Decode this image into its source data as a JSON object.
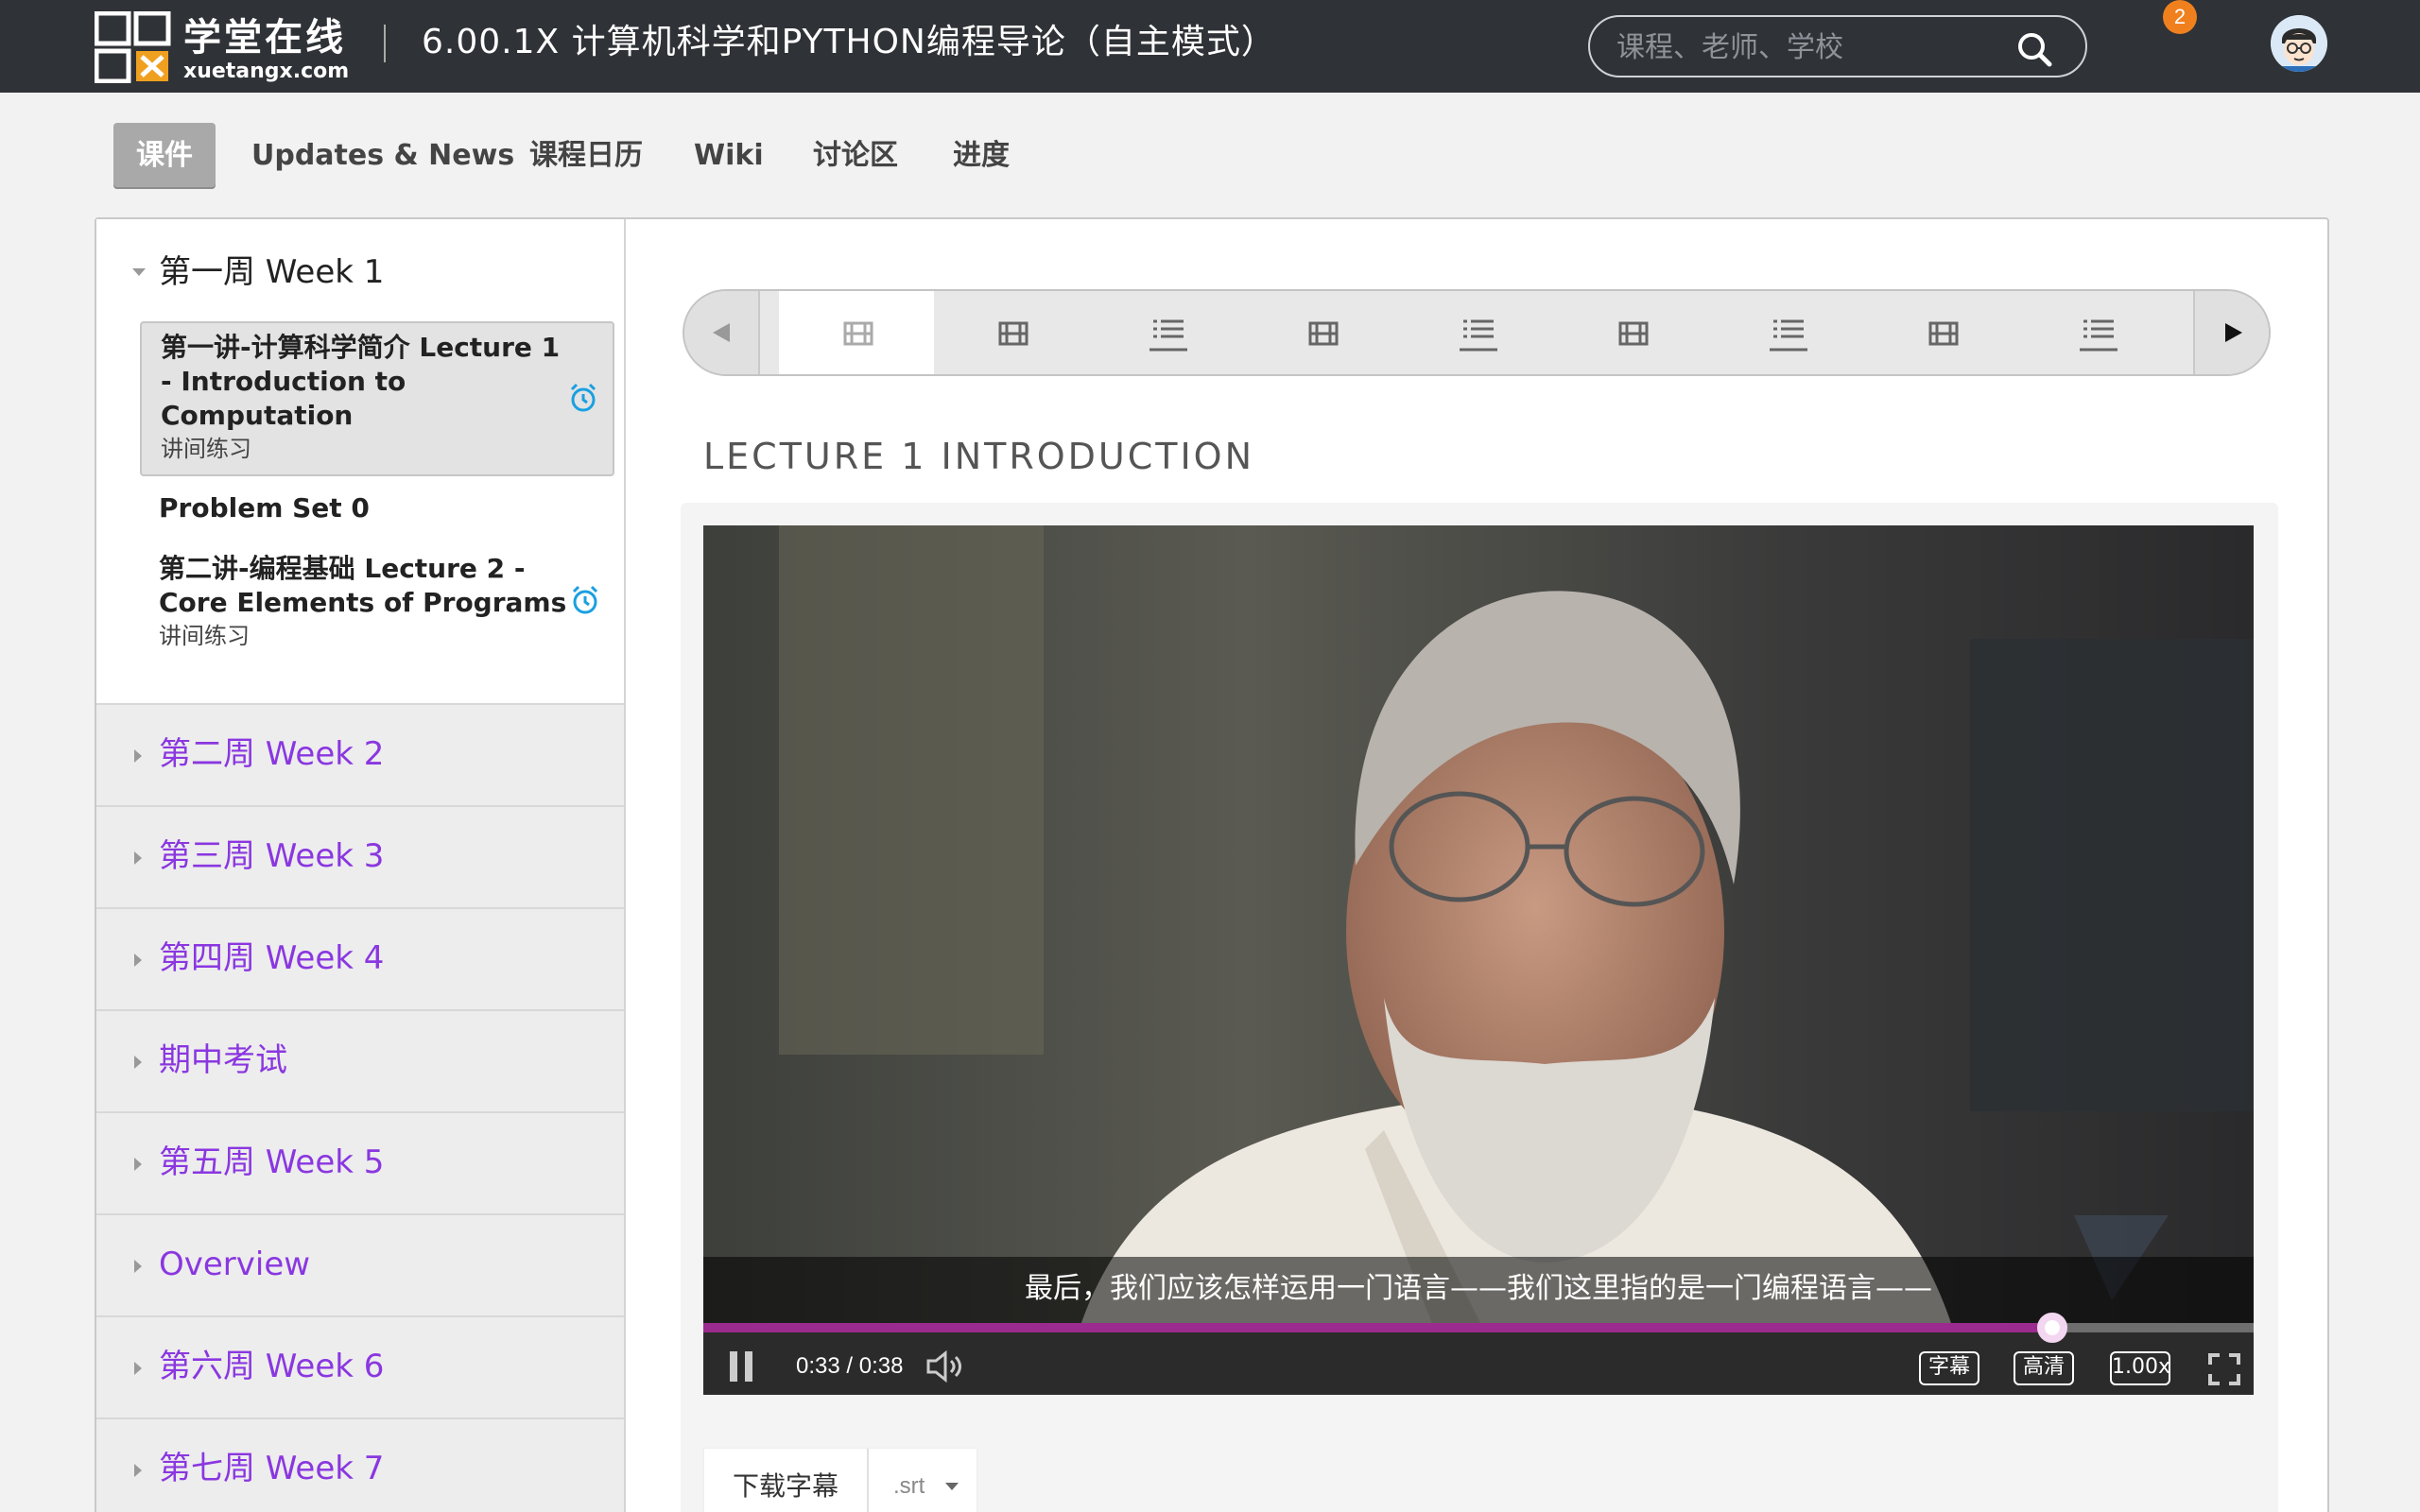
{
  "header": {
    "logo_text": "学堂在线",
    "logo_sub": "xuetangx.com",
    "course_title": "6.00.1X 计算机科学和PYTHON编程导论（自主模式）",
    "search_placeholder": "课程、老师、学校",
    "notification_count": "2",
    "colors": {
      "bar": "#2f3236",
      "badge": "#f0801e"
    }
  },
  "tabs": [
    {
      "label": "课件",
      "active": true
    },
    {
      "label": "Updates & News"
    },
    {
      "label": "课程日历"
    },
    {
      "label": "Wiki"
    },
    {
      "label": "讨论区"
    },
    {
      "label": "进度"
    }
  ],
  "sidebar": {
    "week1": {
      "title": "第一周 Week 1",
      "lessons": [
        {
          "title_lines": [
            "第一讲-计算科学简介 Lecture 1",
            "- Introduction to",
            "Computation"
          ],
          "subtitle": "讲间练习",
          "active": true,
          "icon": "alarm-clock-icon"
        },
        {
          "title_lines": [
            "Problem Set 0"
          ],
          "subtitle": ""
        },
        {
          "title_lines": [
            "第二讲-编程基础 Lecture 2 -",
            "Core Elements of Programs"
          ],
          "subtitle": "讲间练习",
          "icon": "alarm-clock-icon"
        }
      ]
    },
    "weeks": [
      {
        "label": "第二周 Week 2"
      },
      {
        "label": "第三周 Week 3"
      },
      {
        "label": "第四周 Week 4"
      },
      {
        "label": "期中考试"
      },
      {
        "label": "第五周 Week 5"
      },
      {
        "label": "Overview"
      },
      {
        "label": "第六周 Week 6"
      },
      {
        "label": "第七周 Week 7"
      }
    ],
    "link_color": "#8a37e0"
  },
  "sequence": {
    "items": [
      "video-icon",
      "video-icon",
      "list-icon",
      "video-icon",
      "list-icon",
      "video-icon",
      "list-icon",
      "video-icon",
      "list-icon"
    ],
    "active_index": 0
  },
  "unit": {
    "title": "LECTURE 1 INTRODUCTION"
  },
  "video": {
    "caption": "最后，我们应该怎样运用一门语言——我们这里指的是一门编程语言——",
    "time": "0:33 / 0:38",
    "progress": 0.87,
    "buttons": {
      "captions": "字幕",
      "quality": "高清",
      "speed": "1.00x"
    },
    "progress_color": "#9b2b8e"
  },
  "download": {
    "label": "下载字幕",
    "format": ".srt"
  }
}
